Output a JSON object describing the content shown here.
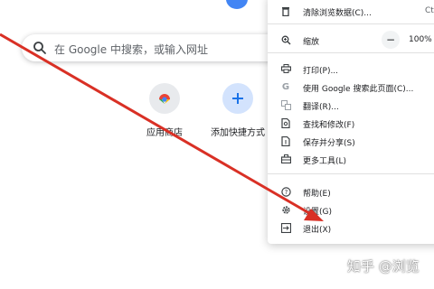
{
  "search": {
    "placeholder": "在 Google 中搜索，或输入网址"
  },
  "shortcuts": [
    {
      "label": "应用商店",
      "icon": "webstore-icon"
    },
    {
      "label": "添加快捷方式",
      "icon": "plus-icon"
    }
  ],
  "menu": {
    "clear_data": {
      "label": "清除浏览数据(C)...",
      "shortcut": "Ct"
    },
    "zoom": {
      "label": "缩放",
      "minus": "−",
      "value": "100%"
    },
    "print": {
      "label": "打印(P)..."
    },
    "search_page": {
      "label": "使用 Google 搜索此页面(C)..."
    },
    "translate": {
      "label": "翻译(R)..."
    },
    "find_edit": {
      "label": "查找和修改(F)"
    },
    "save_share": {
      "label": "保存并分享(S)"
    },
    "more_tools": {
      "label": "更多工具(L)"
    },
    "help": {
      "label": "帮助(E)"
    },
    "settings": {
      "label": "设置(G)"
    },
    "exit": {
      "label": "退出(X)"
    }
  },
  "watermark": "知乎 @浏览",
  "colors": {
    "accent": "#4285f4",
    "arrow": "#d93025"
  }
}
